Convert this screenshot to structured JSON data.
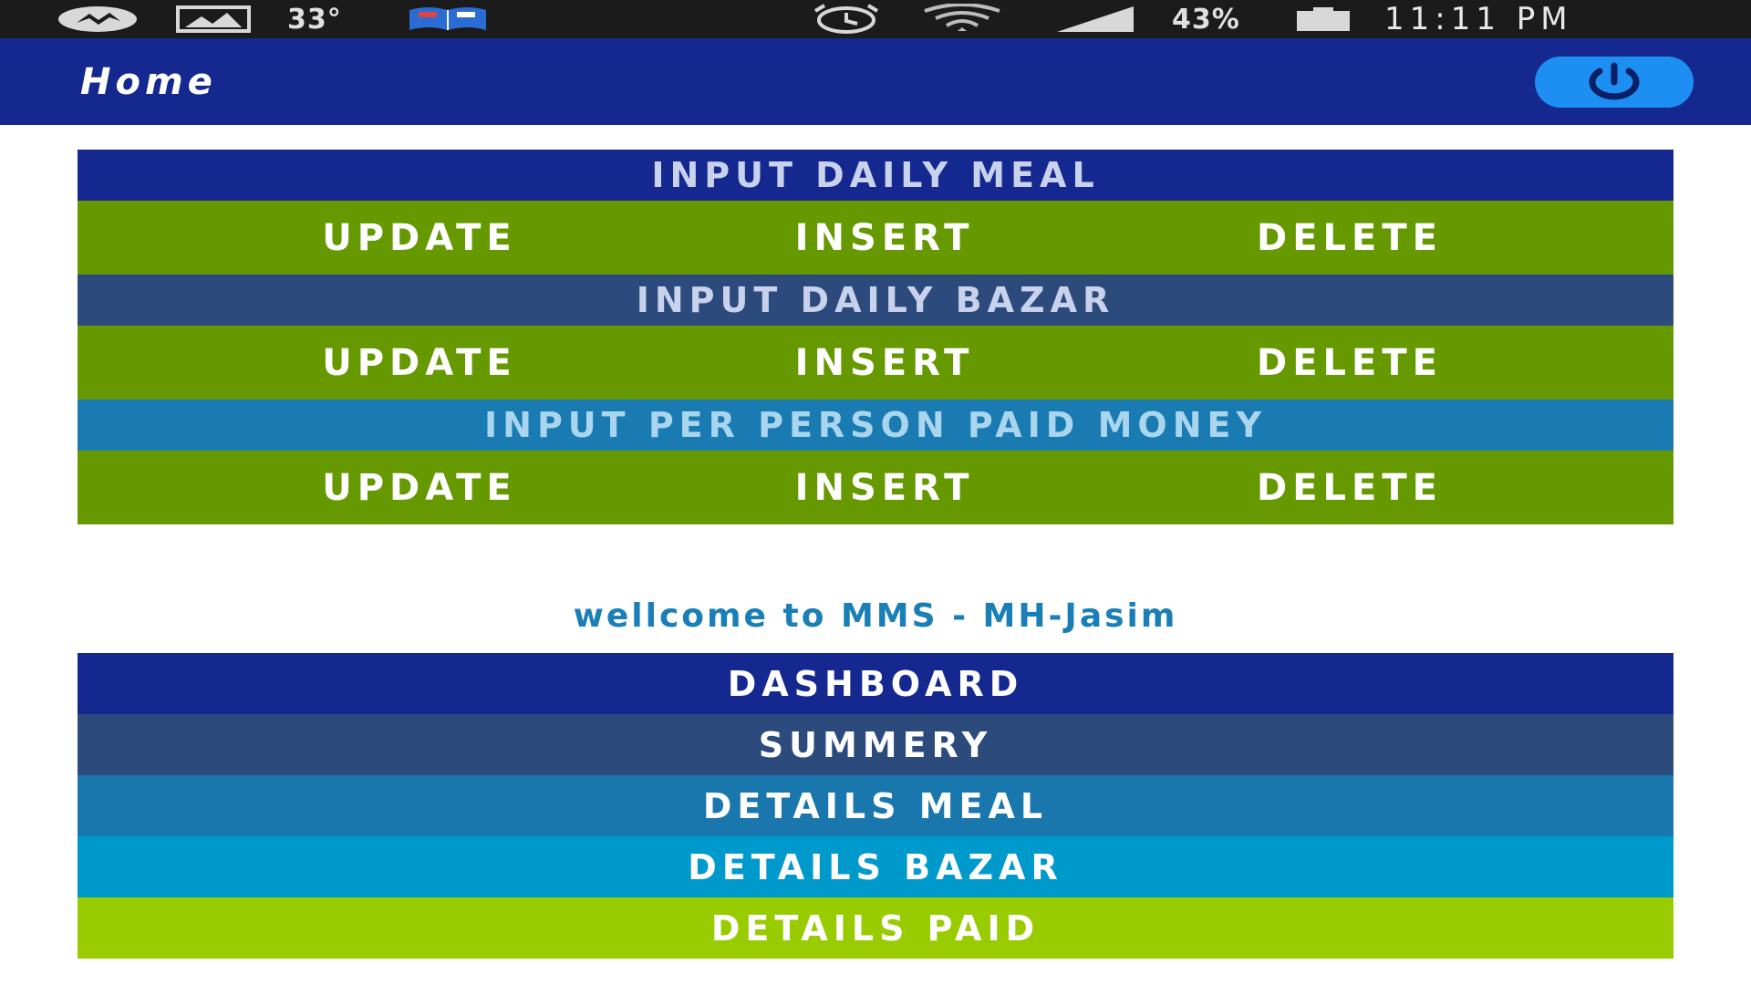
{
  "status_bar": {
    "temperature": "33°",
    "battery_percent": "43%",
    "clock": "11:11 PM"
  },
  "app_bar": {
    "title": "Home"
  },
  "colors": {
    "status_bar_bg": "#1b1b1b",
    "app_bar_bg": "#14288f",
    "power_button": "#1e8ff2",
    "action_green": "#669900",
    "meal_head": "#14288f",
    "bazar_head": "#2c4a7c",
    "paid_head": "#1a7ab2",
    "welcome_text": "#1a7fb6",
    "nav_dashboard": "#14288f",
    "nav_summery": "#2c4a7c",
    "nav_details_meal": "#1a77ad",
    "nav_details_bazar": "#0099cc",
    "nav_details_paid": "#99cc00"
  },
  "sections": [
    {
      "title": "INPUT DAILY MEAL",
      "actions": {
        "update": "UPDATE",
        "insert": "INSERT",
        "delete": "DELETE"
      }
    },
    {
      "title": "INPUT DAILY BAZAR",
      "actions": {
        "update": "UPDATE",
        "insert": "INSERT",
        "delete": "DELETE"
      }
    },
    {
      "title": "INPUT PER PERSON PAID MONEY",
      "actions": {
        "update": "UPDATE",
        "insert": "INSERT",
        "delete": "DELETE"
      }
    }
  ],
  "welcome": "wellcome to MMS - MH-Jasim",
  "nav": {
    "dashboard": "DASHBOARD",
    "summery": "SUMMERY",
    "details_meal": "DETAILS MEAL",
    "details_bazar": "DETAILS BAZAR",
    "details_paid": "DETAILS PAID"
  }
}
